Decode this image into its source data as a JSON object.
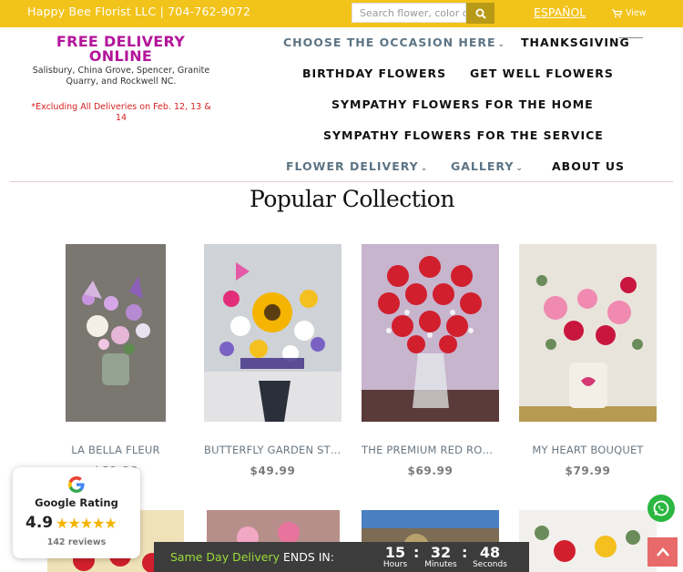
{
  "topbar": {
    "contact": "Happy Bee Florist LLC | 704-762-9072",
    "search_placeholder": "Search flower, color or",
    "language_link": "ESPAÑOL",
    "cart_label": "View"
  },
  "promo": {
    "title_line1": "FREE DELIVERY",
    "title_line2": "ONLINE",
    "areas": "Salisbury, China Grove, Spencer, Granite Quarry, and Rockwell NC.",
    "note": "*Excluding All Deliveries on Feb. 12, 13 & 14"
  },
  "nav": {
    "occasion": "CHOOSE THE OCCASION HERE",
    "thanksgiving": "THANKSGIVING",
    "birthday": "BIRTHDAY FLOWERS",
    "get_well": "GET WELL FLOWERS",
    "sympathy_home": "SYMPATHY FLOWERS FOR THE HOME",
    "sympathy_service": "SYMPATHY FLOWERS FOR THE SERVICE",
    "flower_delivery": "FLOWER DELIVERY",
    "gallery": "GALLERY",
    "about": "ABOUT US"
  },
  "section_title": "Popular Collection",
  "products": [
    {
      "name": "LA BELLA FLEUR",
      "price": "$69.99"
    },
    {
      "name": "BUTTERFLY GARDEN STR...",
      "price": "$49.99"
    },
    {
      "name": "THE PREMIUM RED ROSE...",
      "price": "$69.99"
    },
    {
      "name": "MY HEART BOUQUET",
      "price": "$79.99"
    }
  ],
  "rating": {
    "label": "Google Rating",
    "score": "4.9",
    "stars": 5,
    "reviews": "142 reviews"
  },
  "countdown": {
    "label_green": "Same Day Delivery",
    "label_rest": " ENDS IN:",
    "hours": "15",
    "minutes": "32",
    "seconds": "48",
    "hours_label": "Hours",
    "minutes_label": "Minutes",
    "seconds_label": "Seconds"
  },
  "colors": {
    "topbar": "#f2c31a",
    "promo": "#b3159a",
    "note": "#d81e1e",
    "whatsapp": "#2bb741",
    "countdown_green": "#9bdc3a"
  }
}
